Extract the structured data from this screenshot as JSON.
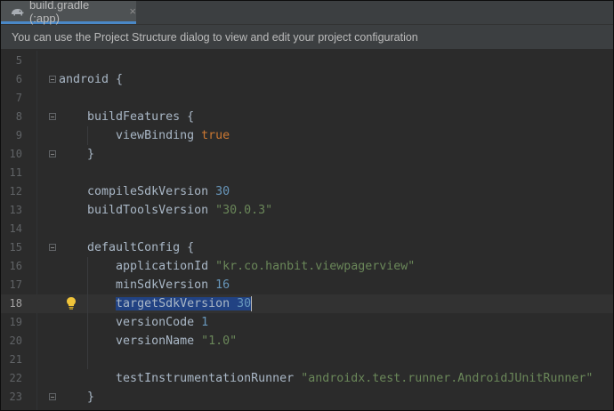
{
  "tab": {
    "title": "build.gradle (:app)",
    "close_glyph": "×",
    "icon": "gradle-elephant-icon"
  },
  "notification": {
    "text": "You can use the Project Structure dialog to view and edit your project configuration"
  },
  "editor": {
    "current_line": "18",
    "lines": [
      {
        "n": "5",
        "tokens": []
      },
      {
        "n": "6",
        "tokens": [
          {
            "t": "android {",
            "c": "plain"
          }
        ]
      },
      {
        "n": "7",
        "tokens": []
      },
      {
        "n": "8",
        "tokens": [
          {
            "t": "    buildFeatures {",
            "c": "plain"
          }
        ]
      },
      {
        "n": "9",
        "tokens": [
          {
            "t": "        viewBinding ",
            "c": "plain"
          },
          {
            "t": "true",
            "c": "kw"
          }
        ]
      },
      {
        "n": "10",
        "tokens": [
          {
            "t": "    }",
            "c": "plain"
          }
        ]
      },
      {
        "n": "11",
        "tokens": []
      },
      {
        "n": "12",
        "tokens": [
          {
            "t": "    compileSdkVersion ",
            "c": "plain"
          },
          {
            "t": "30",
            "c": "num"
          }
        ]
      },
      {
        "n": "13",
        "tokens": [
          {
            "t": "    buildToolsVersion ",
            "c": "plain"
          },
          {
            "t": "\"30.0.3\"",
            "c": "str"
          }
        ]
      },
      {
        "n": "14",
        "tokens": []
      },
      {
        "n": "15",
        "tokens": [
          {
            "t": "    defaultConfig {",
            "c": "plain"
          }
        ]
      },
      {
        "n": "16",
        "tokens": [
          {
            "t": "        applicationId ",
            "c": "plain"
          },
          {
            "t": "\"kr.co.hanbit.viewpagerview\"",
            "c": "str"
          }
        ]
      },
      {
        "n": "17",
        "tokens": [
          {
            "t": "        minSdkVersion ",
            "c": "plain"
          },
          {
            "t": "16",
            "c": "num"
          }
        ]
      },
      {
        "n": "18",
        "tokens": [
          {
            "t": "        ",
            "c": "plain"
          },
          {
            "t": "targetSdkVersion ",
            "c": "sel"
          },
          {
            "t": "30",
            "c": "selnum"
          }
        ]
      },
      {
        "n": "19",
        "tokens": [
          {
            "t": "        versionCode ",
            "c": "plain"
          },
          {
            "t": "1",
            "c": "num"
          }
        ]
      },
      {
        "n": "20",
        "tokens": [
          {
            "t": "        versionName ",
            "c": "plain"
          },
          {
            "t": "\"1.0\"",
            "c": "str"
          }
        ]
      },
      {
        "n": "21",
        "tokens": []
      },
      {
        "n": "22",
        "tokens": [
          {
            "t": "        testInstrumentationRunner ",
            "c": "plain"
          },
          {
            "t": "\"androidx.test.runner.AndroidJUnitRunner\"",
            "c": "str"
          }
        ]
      },
      {
        "n": "23",
        "tokens": [
          {
            "t": "    }",
            "c": "plain"
          }
        ]
      }
    ],
    "fold_markers": [
      "6",
      "8",
      "10",
      "15",
      "23"
    ],
    "intention_icon": "lightbulb-icon"
  },
  "colors": {
    "background": "#2b2b2b",
    "plain": "#a9b7c6",
    "keyword": "#cc7832",
    "number": "#6897bb",
    "string": "#6a8759",
    "selection": "#214283",
    "tab_underline": "#4a88c7"
  }
}
